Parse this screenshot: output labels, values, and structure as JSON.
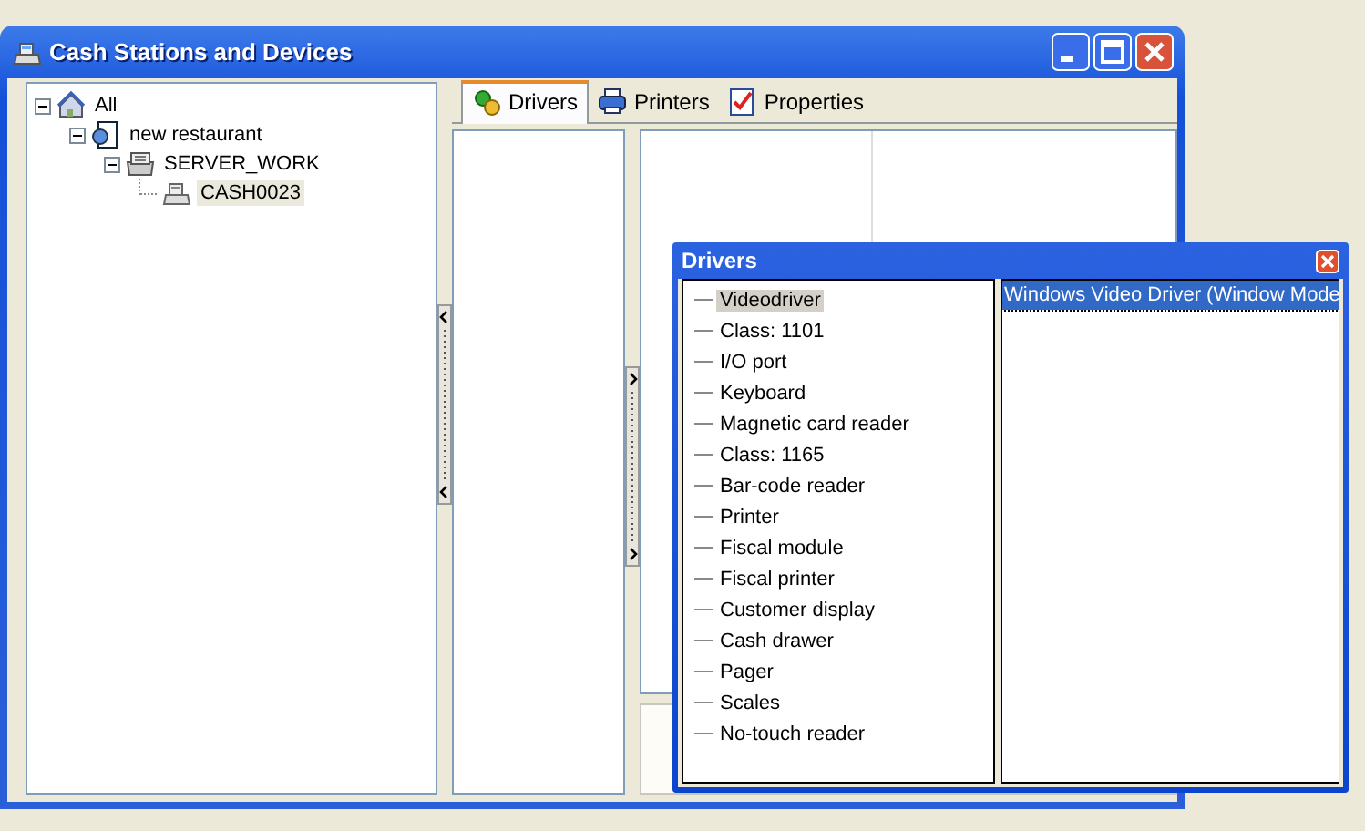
{
  "window": {
    "title": "Cash Stations and Devices"
  },
  "tree": [
    {
      "label": "All",
      "kind": "home",
      "expanded": true,
      "selected": false,
      "children": [
        {
          "label": "new restaurant",
          "kind": "site",
          "expanded": true,
          "selected": false,
          "children": [
            {
              "label": "SERVER_WORK",
              "kind": "server",
              "expanded": true,
              "selected": false,
              "children": [
                {
                  "label": "CASH0023",
                  "kind": "cash",
                  "selected": true
                }
              ]
            }
          ]
        }
      ]
    }
  ],
  "tabs": [
    {
      "label": "Drivers",
      "kind": "drivers",
      "selected": true
    },
    {
      "label": "Printers",
      "kind": "printer",
      "selected": false
    },
    {
      "label": "Properties",
      "kind": "properties",
      "selected": false
    }
  ],
  "drivers_dialog": {
    "title": "Drivers",
    "items": [
      {
        "label": "Videodriver",
        "selected": true
      },
      {
        "label": "Class: 1101",
        "selected": false
      },
      {
        "label": "I/O port",
        "selected": false
      },
      {
        "label": "Keyboard",
        "selected": false
      },
      {
        "label": "Magnetic card reader",
        "selected": false
      },
      {
        "label": "Class: 1165",
        "selected": false
      },
      {
        "label": "Bar-code reader",
        "selected": false
      },
      {
        "label": "Printer",
        "selected": false
      },
      {
        "label": "Fiscal module",
        "selected": false
      },
      {
        "label": "Fiscal printer",
        "selected": false
      },
      {
        "label": "Customer display",
        "selected": false
      },
      {
        "label": "Cash drawer",
        "selected": false
      },
      {
        "label": "Pager",
        "selected": false
      },
      {
        "label": "Scales",
        "selected": false
      },
      {
        "label": "No-touch reader",
        "selected": false
      }
    ],
    "drivers": [
      {
        "label": "Windows Video Driver (Window Mode",
        "selected": true
      }
    ]
  }
}
